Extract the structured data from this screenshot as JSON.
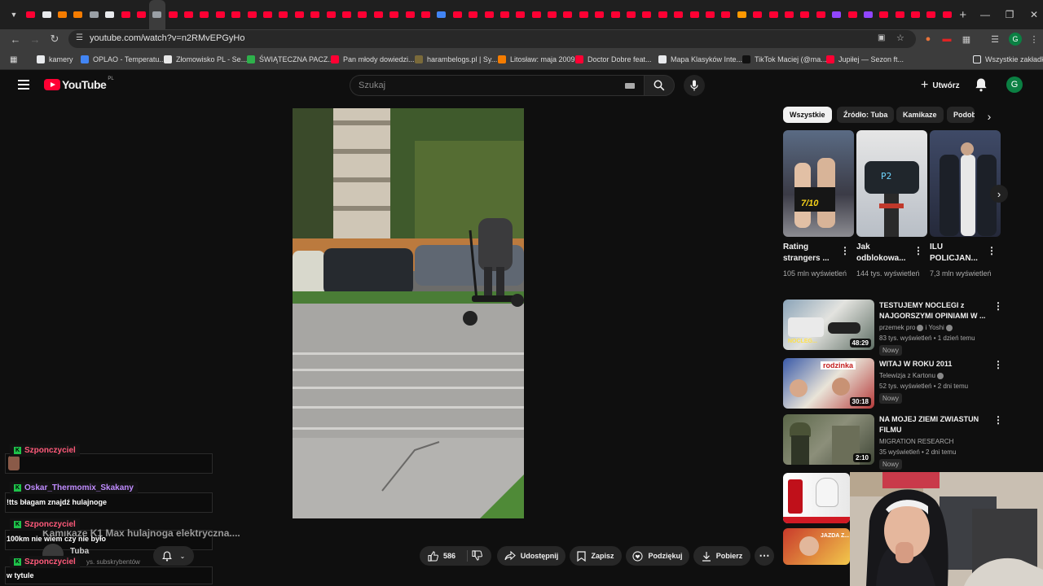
{
  "browser": {
    "url": "youtube.com/watch?v=n2RMvEPGyHo",
    "tab_count": 59,
    "bookmarks": [
      {
        "label": "kamery",
        "icon": "folder-icon",
        "color": "#e8eaed"
      },
      {
        "label": "OPLAO - Temperatu...",
        "icon": "site-icon",
        "color": "#4285f4"
      },
      {
        "label": "Złomowisko PL - Se...",
        "icon": "v-icon",
        "color": "#e8e8e8"
      },
      {
        "label": "ŚWIĄTECZNA PACZ...",
        "icon": "plus-icon",
        "color": "#2eb14b"
      },
      {
        "label": "Pan młody dowiedzi...",
        "icon": "youtube-icon",
        "color": "#ff0033"
      },
      {
        "label": "harambelogs.pl | Sy...",
        "icon": "site-icon",
        "color": "#7a6a3a"
      },
      {
        "label": "Litosław: maja 2009",
        "icon": "blogger-icon",
        "color": "#f57c00"
      },
      {
        "label": "Doctor Dobre feat...",
        "icon": "youtube-icon",
        "color": "#ff0033"
      },
      {
        "label": "Mapa Klasyków Inte...",
        "icon": "google-icon",
        "color": "#e8eaed"
      },
      {
        "label": "TikTok Maciej (@ma...",
        "icon": "tiktok-icon",
        "color": "#111111"
      },
      {
        "label": "Jupiłej — Sezon ft...",
        "icon": "youtube-icon",
        "color": "#ff0033"
      }
    ],
    "all_bookmarks": "Wszystkie zakładki"
  },
  "header": {
    "logo_text": "YouTube",
    "logo_region": "PL",
    "search_placeholder": "Szukaj",
    "create_label": "Utwórz",
    "avatar_letter": "G"
  },
  "chat": [
    {
      "user": "Szponczyciel",
      "text": "",
      "user_color": "#ff5a7a"
    },
    {
      "user": "Oskar_Thermomix_Skakany",
      "text": "!tts błagam znajdź hulajnoge",
      "user_color": "#c08cff"
    },
    {
      "user": "Szponczyciel",
      "text": "100km nie wiem czy nie było",
      "user_color": "#ff5a7a"
    },
    {
      "user": "Szponczyciel",
      "text": "w tytule",
      "user_color": "#ff5a7a"
    }
  ],
  "video": {
    "title_partial": "Kamikaze K1 Max hulajnoga elektryczna....",
    "channel": "Tuba",
    "subs_partial": "ys. subskrybentów",
    "likes": "586",
    "share_label": "Udostępnij",
    "save_label": "Zapisz",
    "thanks_label": "Podziękuj",
    "download_label": "Pobierz"
  },
  "chips": [
    "Wszystkie",
    "Źródło: Tuba",
    "Kamikaze",
    "Podob"
  ],
  "shorts": [
    {
      "title": "Rating strangers ...",
      "views": "105 mln wyświetleń",
      "overlay": "7/10"
    },
    {
      "title": "Jak odblokowa...",
      "views": "144 tys. wyświetleń",
      "overlay": "P2"
    },
    {
      "title": "ILU POLICJAN...",
      "views": "7,3 mln wyświetleń",
      "overlay": ""
    }
  ],
  "recommendations": [
    {
      "title": "TESTUJEMY NOCLEGI z NAJGORSZYMI OPINIAMI W ...",
      "channel": "przemek pro",
      "channel_extra": "i Yoshi",
      "meta": "83 tys. wyświetleń • 1 dzień temu",
      "badge": "Nowy",
      "duration": "48:29"
    },
    {
      "title": "WITAJ W ROKU 2011",
      "channel": "Telewizja z Kartonu",
      "channel_extra": "",
      "meta": "52 tys. wyświetleń • 2 dni temu",
      "badge": "Nowy",
      "duration": "30:18"
    },
    {
      "title": "NA MOJEJ ZIEMI ZWIASTUN FILMU",
      "channel": "MIGRATION RESEARCH",
      "channel_extra": "",
      "meta": "35 wyświetleń • 2 dni temu",
      "badge": "Nowy",
      "duration": "2:10"
    }
  ],
  "colors": {
    "accent": "#ff0033",
    "chat_badge": "#1ec24a",
    "background": "#0f0f0f"
  }
}
